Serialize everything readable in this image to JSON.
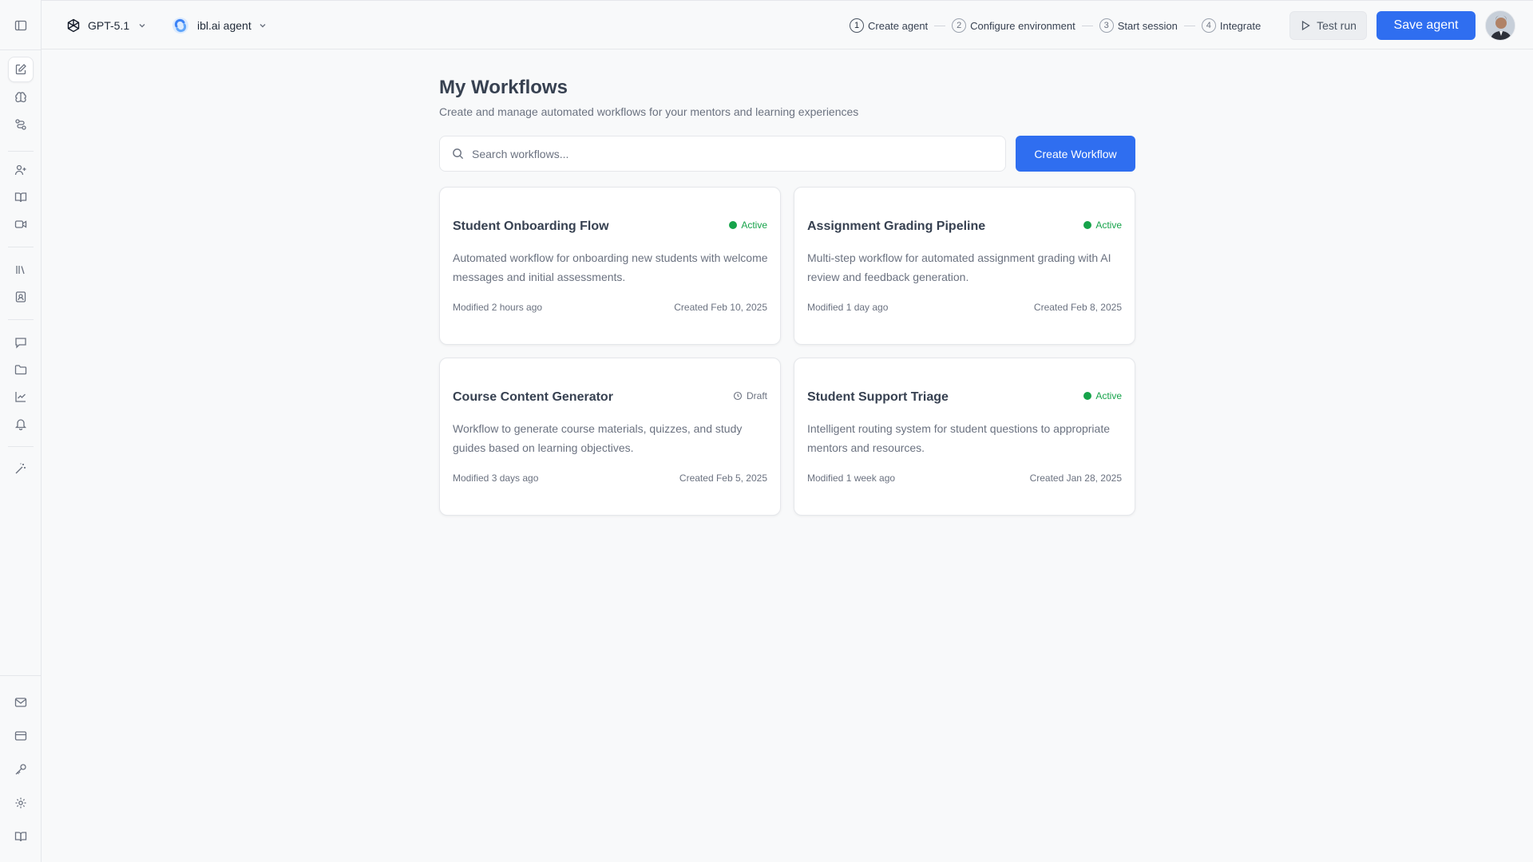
{
  "header": {
    "model_label": "GPT-5.1",
    "agent_label": "ibl.ai agent",
    "steps": [
      {
        "num": "1",
        "label": "Create agent"
      },
      {
        "num": "2",
        "label": "Configure environment"
      },
      {
        "num": "3",
        "label": "Start session"
      },
      {
        "num": "4",
        "label": "Integrate"
      }
    ],
    "test_run_label": "Test run",
    "save_label": "Save agent"
  },
  "main": {
    "title": "My Workflows",
    "subtitle": "Create and manage automated workflows for your mentors and learning experiences",
    "search_placeholder": "Search workflows...",
    "create_label": "Create Workflow"
  },
  "workflows": [
    {
      "title": "Student Onboarding Flow",
      "status": "Active",
      "status_type": "active",
      "description": "Automated workflow for onboarding new students with welcome messages and initial assessments.",
      "modified": "Modified 2 hours ago",
      "created": "Created Feb 10, 2025"
    },
    {
      "title": "Assignment Grading Pipeline",
      "status": "Active",
      "status_type": "active",
      "description": "Multi-step workflow for automated assignment grading with AI review and feedback generation.",
      "modified": "Modified 1 day ago",
      "created": "Created Feb 8, 2025"
    },
    {
      "title": "Course Content Generator",
      "status": "Draft",
      "status_type": "draft",
      "description": "Workflow to generate course materials, quizzes, and study guides based on learning objectives.",
      "modified": "Modified 3 days ago",
      "created": "Created Feb 5, 2025"
    },
    {
      "title": "Student Support Triage",
      "status": "Active",
      "status_type": "active",
      "description": "Intelligent routing system for student questions to appropriate mentors and resources.",
      "modified": "Modified 1 week ago",
      "created": "Created Jan 28, 2025"
    }
  ],
  "colors": {
    "accent": "#2f6ef0",
    "active": "#16a34a",
    "muted": "#6b7280"
  }
}
